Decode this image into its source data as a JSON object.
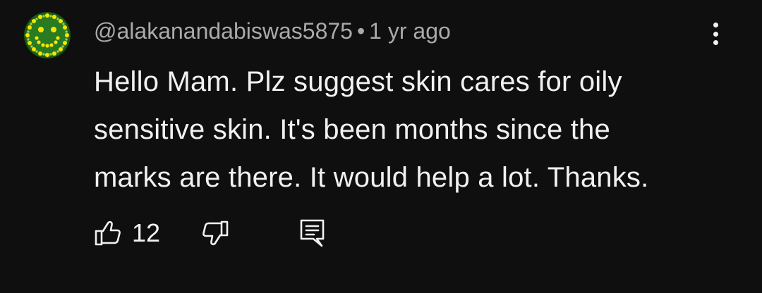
{
  "comment": {
    "author": "@alakanandabiswas5875",
    "separator": "•",
    "timestamp": "1 yr ago",
    "body_lines": [
      "Hello Mam. Plz suggest skin cares for oily",
      "sensitive skin. It's been months since the",
      "marks are there. It would help a lot. Thanks."
    ],
    "like_count": "12",
    "avatar_icon": "smiley-flower-avatar",
    "more_icon": "more-vertical-icon",
    "like_icon": "thumbs-up-icon",
    "dislike_icon": "thumbs-down-icon",
    "reply_icon": "reply-comment-icon"
  },
  "colors": {
    "background": "#0f0f0f",
    "text_primary": "#f1f1f1",
    "text_secondary": "#aaaaaa",
    "avatar_green": "#1f6b1a",
    "avatar_yellow": "#f2e600"
  }
}
